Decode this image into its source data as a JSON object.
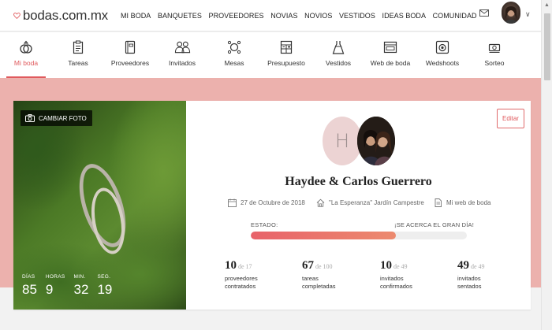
{
  "brand": {
    "name": "bodas.com.mx",
    "accent": "#e05a5d",
    "band_color": "#ecb1ad"
  },
  "topnav": {
    "items": [
      "MI BODA",
      "BANQUETES",
      "PROVEEDORES",
      "NOVIAS",
      "NOVIOS",
      "VESTIDOS",
      "IDEAS BODA",
      "COMUNIDAD"
    ],
    "icons": [
      "mail-icon",
      "avatar",
      "chevron-down-icon"
    ],
    "chevron": "∨"
  },
  "subnav": {
    "items": [
      {
        "label": "Mi boda",
        "icon": "rings-icon",
        "active": true
      },
      {
        "label": "Tareas",
        "icon": "clipboard-icon",
        "active": false
      },
      {
        "label": "Proveedores",
        "icon": "notebook-icon",
        "active": false
      },
      {
        "label": "Invitados",
        "icon": "people-icon",
        "active": false
      },
      {
        "label": "Mesas",
        "icon": "table-icon",
        "active": false
      },
      {
        "label": "Presupuesto",
        "icon": "calculator-icon",
        "active": false
      },
      {
        "label": "Vestidos",
        "icon": "dress-icon",
        "active": false
      },
      {
        "label": "Web de boda",
        "icon": "browser-icon",
        "active": false
      },
      {
        "label": "Wedshoots",
        "icon": "camera-icon",
        "active": false
      },
      {
        "label": "Sorteo",
        "icon": "gift-icon",
        "active": false
      }
    ]
  },
  "card": {
    "change_photo_label": "CAMBIAR FOTO",
    "edit_label": "Editar",
    "initial": "H",
    "couple_names": "Haydee & Carlos Guerrero",
    "date": "27 de Octubre de 2018",
    "venue": "\"La Esperanza\" Jardín Campestre",
    "web_link": "Mi web de boda",
    "status_label": "ESTADO:",
    "status_text": "¡SE ACERCA EL GRAN DÍA!",
    "progress_fraction": 0.67,
    "countdown": [
      {
        "unit": "DÍAS",
        "value": "85"
      },
      {
        "unit": "HORAS",
        "value": "9"
      },
      {
        "unit": "MIN.",
        "value": "32"
      },
      {
        "unit": "SEG.",
        "value": "19"
      }
    ],
    "stats": [
      {
        "value": "10",
        "total": "de 17",
        "desc": "proveedores contratados"
      },
      {
        "value": "67",
        "total": "de 100",
        "desc": "tareas completadas"
      },
      {
        "value": "10",
        "total": "de 49",
        "desc": "invitados confirmados"
      },
      {
        "value": "49",
        "total": "de 49",
        "desc": "invitados sentados"
      }
    ]
  }
}
